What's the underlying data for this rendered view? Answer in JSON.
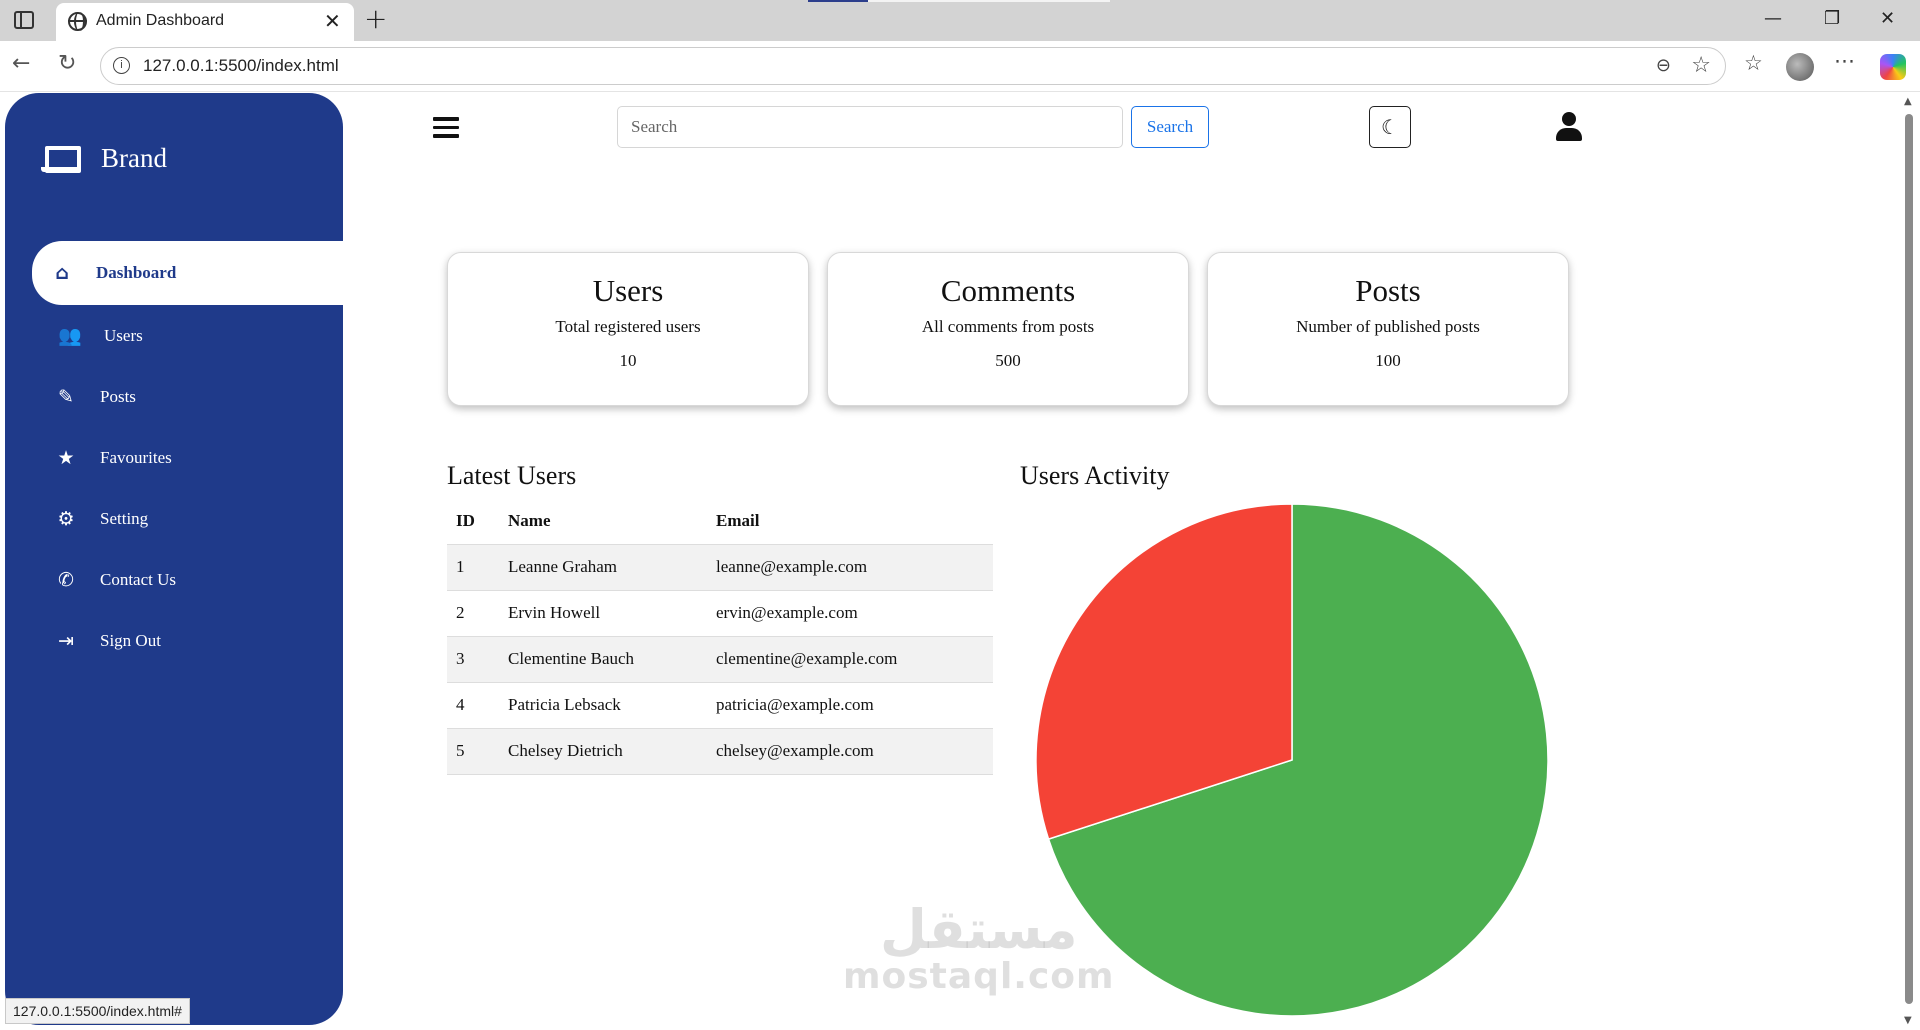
{
  "browser": {
    "tab_title": "Admin Dashboard",
    "url": "127.0.0.1:5500/index.html",
    "status_url": "127.0.0.1:5500/index.html#"
  },
  "sidebar": {
    "brand": "Brand",
    "items": [
      {
        "label": "Dashboard",
        "icon": "home-icon",
        "active": true
      },
      {
        "label": "Users",
        "icon": "users-icon"
      },
      {
        "label": "Posts",
        "icon": "edit-icon"
      },
      {
        "label": "Favourites",
        "icon": "star-icon"
      },
      {
        "label": "Setting",
        "icon": "gear-icon"
      },
      {
        "label": "Contact Us",
        "icon": "phone-icon"
      },
      {
        "label": "Sign Out",
        "icon": "sign-out-icon"
      }
    ]
  },
  "header": {
    "search_placeholder": "Search",
    "search_button": "Search"
  },
  "cards": [
    {
      "title": "Users",
      "description": "Total registered users",
      "value": "10"
    },
    {
      "title": "Comments",
      "description": "All comments from posts",
      "value": "500"
    },
    {
      "title": "Posts",
      "description": "Number of published posts",
      "value": "100"
    }
  ],
  "latest_users": {
    "title": "Latest Users",
    "columns": [
      "ID",
      "Name",
      "Email"
    ],
    "rows": [
      [
        "1",
        "Leanne Graham",
        "leanne@example.com"
      ],
      [
        "2",
        "Ervin Howell",
        "ervin@example.com"
      ],
      [
        "3",
        "Clementine Bauch",
        "clementine@example.com"
      ],
      [
        "4",
        "Patricia Lebsack",
        "patricia@example.com"
      ],
      [
        "5",
        "Chelsey Dietrich",
        "chelsey@example.com"
      ]
    ]
  },
  "activity": {
    "title": "Users Activity"
  },
  "chart_data": {
    "type": "pie",
    "title": "",
    "values": [
      70,
      30
    ],
    "colors": [
      "#4caf50",
      "#f44336"
    ]
  },
  "watermark": {
    "arabic": "مستقل",
    "latin": "mostaql.com"
  },
  "colors": {
    "sidebar": "#1f3a8a",
    "accent": "#1a73e8"
  }
}
